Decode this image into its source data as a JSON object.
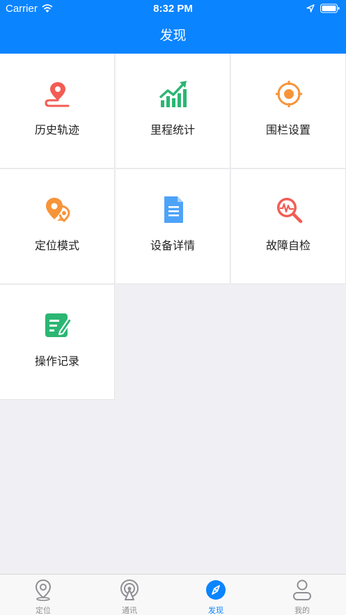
{
  "status_bar": {
    "carrier": "Carrier",
    "time": "8:32 PM"
  },
  "nav": {
    "title": "发现"
  },
  "grid": {
    "items": [
      {
        "label": "历史轨迹",
        "icon": "track-pin-icon"
      },
      {
        "label": "里程统计",
        "icon": "trend-chart-icon"
      },
      {
        "label": "围栏设置",
        "icon": "fence-target-icon"
      },
      {
        "label": "定位模式",
        "icon": "location-mode-icon"
      },
      {
        "label": "设备详情",
        "icon": "document-icon"
      },
      {
        "label": "故障自检",
        "icon": "diagnostic-search-icon"
      },
      {
        "label": "操作记录",
        "icon": "edit-record-icon"
      }
    ]
  },
  "tabbar": {
    "tabs": [
      {
        "label": "定位",
        "icon": "location-pin-icon",
        "active": false
      },
      {
        "label": "通讯",
        "icon": "antenna-icon",
        "active": false
      },
      {
        "label": "发现",
        "icon": "compass-icon",
        "active": true
      },
      {
        "label": "我的",
        "icon": "user-icon",
        "active": false
      }
    ]
  },
  "colors": {
    "primary": "#0a84ff",
    "red": "#f25c54",
    "green": "#2bb673",
    "orange": "#f7943a",
    "blue": "#4da3f7",
    "inactive": "#8e8e93"
  }
}
